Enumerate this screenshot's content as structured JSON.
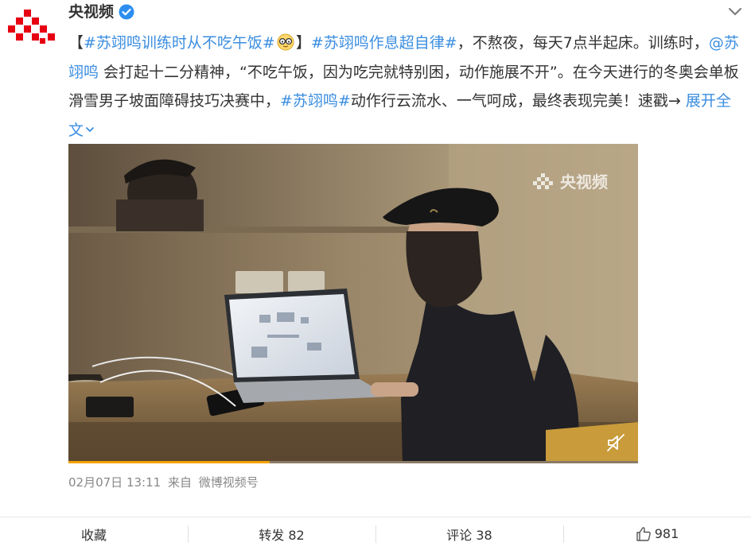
{
  "post": {
    "author": "央视频",
    "segments": [
      {
        "text": "【",
        "kind": "plain"
      },
      {
        "text": "#苏翊鸣训练时从不吃午饭#",
        "kind": "tag"
      },
      {
        "text": "",
        "kind": "emoji",
        "icon": "face-glasses-emoji"
      },
      {
        "text": "】",
        "kind": "plain"
      },
      {
        "text": "#苏翊鸣作息超自律#",
        "kind": "tag"
      },
      {
        "text": "，不熬夜，每天7点半起床。训练时，",
        "kind": "plain"
      },
      {
        "text": "@苏翊鸣",
        "kind": "mention"
      },
      {
        "text": " 会打起十二分精神，“不吃午饭，因为吃完就特别困，动作施展不开”。在今天进行的冬奥会单板滑雪男子坡面障碍技巧决赛中，",
        "kind": "plain"
      },
      {
        "text": "#苏翊鸣#",
        "kind": "tag"
      },
      {
        "text": "动作行云流水、一气呵成，最终表现完美！速戳→ ",
        "kind": "plain"
      }
    ],
    "expand_label": "展开全文"
  },
  "video": {
    "watermark": "央视频",
    "progress": 0.354
  },
  "meta": {
    "date": "02月07日 13:11",
    "source_prefix": "来自",
    "source": "微博视频号"
  },
  "actions": {
    "collect": "收藏",
    "repost": "转发 82",
    "comment": "评论 38",
    "like": "981"
  },
  "colors": {
    "link": "#3b8ee0",
    "text": "#333333",
    "meta": "#888888",
    "progress": "#f5a100",
    "brand_red": "#e60012"
  }
}
